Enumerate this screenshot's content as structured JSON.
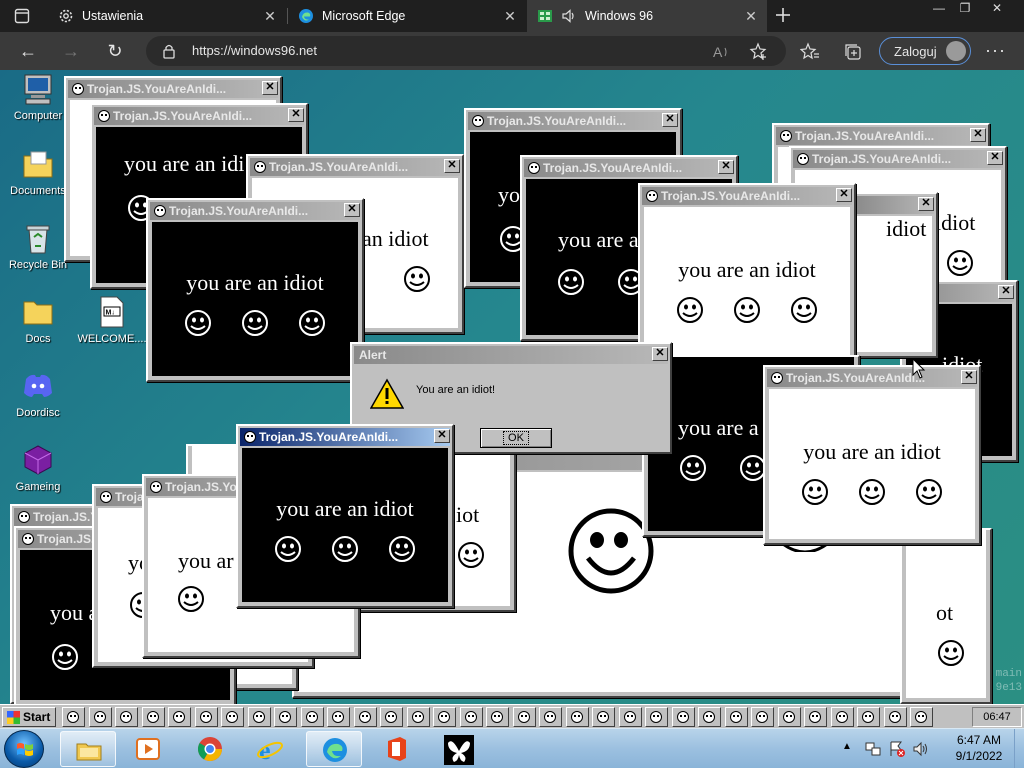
{
  "browser": {
    "tabs": [
      {
        "label": "Ustawienia",
        "icon": "gear-icon"
      },
      {
        "label": "Microsoft Edge",
        "icon": "edge-icon"
      },
      {
        "label": "Windows 96",
        "icon": "windows96-icon",
        "active": true
      }
    ],
    "url": "https://windows96.net",
    "signin_label": "Zaloguj"
  },
  "desktop": {
    "icons": [
      {
        "label": "Computer",
        "icon": "computer-icon"
      },
      {
        "label": "Documents",
        "icon": "documents-folder-icon"
      },
      {
        "label": "Recycle Bin",
        "icon": "recycle-bin-icon"
      },
      {
        "label": "Docs",
        "icon": "folder-icon"
      },
      {
        "label": "WELCOME....",
        "icon": "markdown-file-icon"
      },
      {
        "label": "Doordisc",
        "icon": "discord-icon"
      },
      {
        "label": "Gameing",
        "icon": "game-cube-icon"
      }
    ],
    "popup_title": "Trojan.JS.YouAreAnIdi...",
    "popup_title_active": "Trojan.JS.YouAreAnIdi...",
    "popup_text": "you are an idiot",
    "cropped_texts": {
      "idiot_cut_a": "you are an idi",
      "an_idiot": "an idiot",
      "yo": "yo",
      "you_are_a": "you are a",
      "you_are_a2": "you are a",
      "idiot_right": "idiot",
      "idiot_right2": "idiot",
      "idiot_right3": "idiot",
      "you_ar": "you ar",
      "yo2": "yo",
      "you_a": "you a",
      "iot": "iot",
      "ot": "ot",
      "trojan_short_a": "Troja",
      "trojan_short_b": "Trojan.JS.Yo",
      "trojan_short_c": "Trojan.JS.Y",
      "trojan_short_d": "Trojan.JS.Yo"
    },
    "watermark": [
      "main",
      "9e13"
    ]
  },
  "alert": {
    "title": "Alert",
    "message": "You are an idiot!",
    "ok_label": "OK"
  },
  "w96_taskbar": {
    "start_label": "Start",
    "clock": "06:47"
  },
  "win7_taskbar": {
    "pinned": [
      "file-explorer-icon",
      "media-player-icon",
      "chrome-icon",
      "internet-explorer-icon",
      "edge-icon",
      "office-icon",
      "butterfly-app-icon"
    ],
    "time": "6:47 AM",
    "date": "9/1/2022"
  }
}
